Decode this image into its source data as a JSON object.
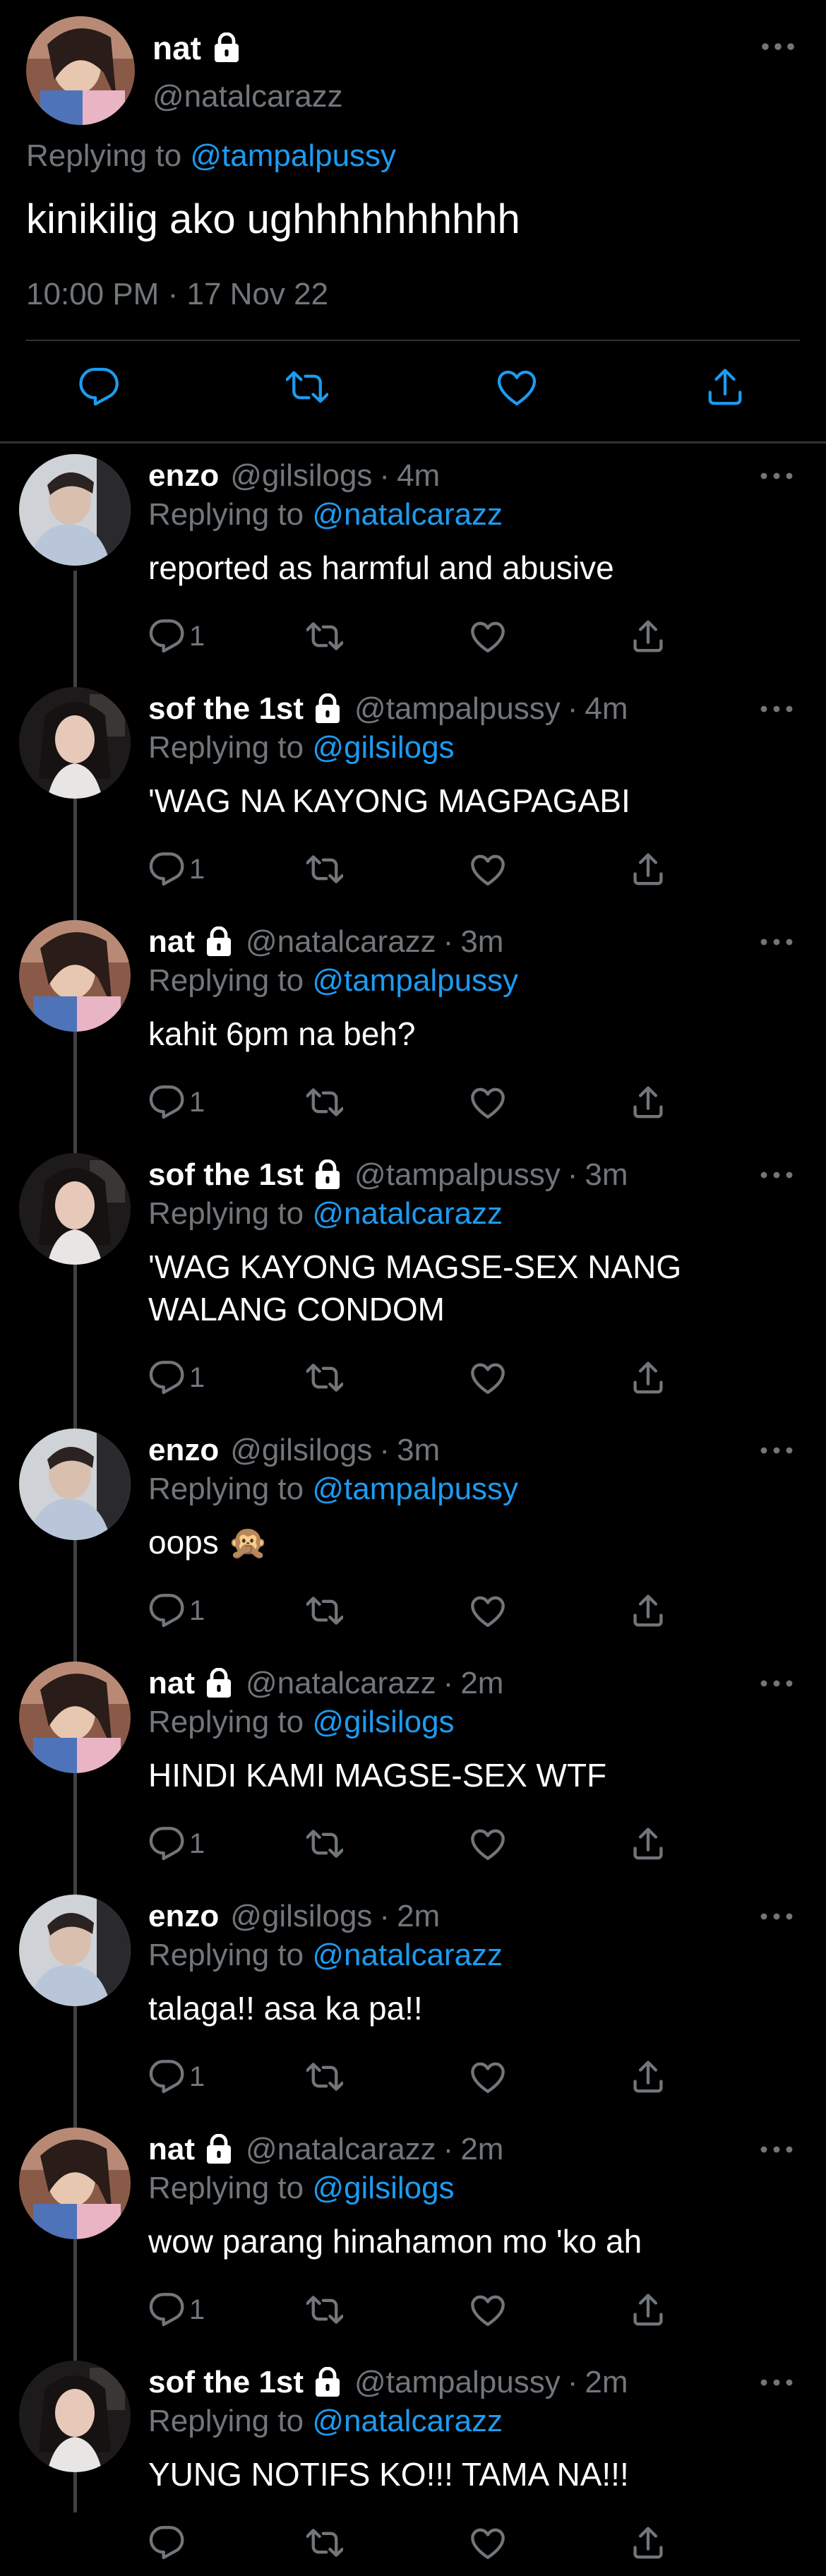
{
  "main_tweet": {
    "name": "nat",
    "handle": "@natalcarazz",
    "replying_prefix": "Replying to",
    "replying_to": "@tampalpussy",
    "text": "kinikilig ako ughhhhhhhhhh",
    "time": "10:00 PM",
    "separator": "·",
    "date": "17 Nov 22",
    "avatar": "avatar-nat",
    "locked": true
  },
  "replies": [
    {
      "name": "enzo",
      "locked": false,
      "handle": "@gilsilogs",
      "time": "4m",
      "replying_prefix": "Replying to",
      "replying_to": "@natalcarazz",
      "text": "reported as harmful and abusive",
      "reply_count": "1",
      "avatar": "avatar-enzo"
    },
    {
      "name": "sof the 1st",
      "locked": true,
      "handle": "@tampalpussy",
      "time": "4m",
      "replying_prefix": "Replying to",
      "replying_to": "@gilsilogs",
      "text": "'WAG NA KAYONG MAGPAGABI",
      "reply_count": "1",
      "avatar": "avatar-sof"
    },
    {
      "name": "nat",
      "locked": true,
      "handle": "@natalcarazz",
      "time": "3m",
      "replying_prefix": "Replying to",
      "replying_to": "@tampalpussy",
      "text": "kahit 6pm na beh?",
      "reply_count": "1",
      "avatar": "avatar-nat"
    },
    {
      "name": "sof the 1st",
      "locked": true,
      "handle": "@tampalpussy",
      "time": "3m",
      "replying_prefix": "Replying to",
      "replying_to": "@natalcarazz",
      "text": "'WAG KAYONG MAGSE-SEX NANG WALANG CONDOM",
      "reply_count": "1",
      "avatar": "avatar-sof"
    },
    {
      "name": "enzo",
      "locked": false,
      "handle": "@gilsilogs",
      "time": "3m",
      "replying_prefix": "Replying to",
      "replying_to": "@tampalpussy",
      "text": "oops 🙊",
      "reply_count": "1",
      "avatar": "avatar-enzo"
    },
    {
      "name": "nat",
      "locked": true,
      "handle": "@natalcarazz",
      "time": "2m",
      "replying_prefix": "Replying to",
      "replying_to": "@gilsilogs",
      "text": "HINDI KAMI MAGSE-SEX WTF",
      "reply_count": "1",
      "avatar": "avatar-nat"
    },
    {
      "name": "enzo",
      "locked": false,
      "handle": "@gilsilogs",
      "time": "2m",
      "replying_prefix": "Replying to",
      "replying_to": "@natalcarazz",
      "text": "talaga!! asa ka pa!!",
      "reply_count": "1",
      "avatar": "avatar-enzo"
    },
    {
      "name": "nat",
      "locked": true,
      "handle": "@natalcarazz",
      "time": "2m",
      "replying_prefix": "Replying to",
      "replying_to": "@gilsilogs",
      "text": "wow parang hinahamon mo 'ko ah",
      "reply_count": "1",
      "avatar": "avatar-nat"
    },
    {
      "name": "sof the 1st",
      "locked": true,
      "handle": "@tampalpussy",
      "time": "2m",
      "replying_prefix": "Replying to",
      "replying_to": "@natalcarazz",
      "text": "YUNG NOTIFS KO!!! TAMA NA!!!",
      "reply_count": "",
      "avatar": "avatar-sof"
    }
  ],
  "icons": {
    "reply": "reply-icon",
    "retweet": "retweet-icon",
    "like": "like-icon",
    "share": "share-icon",
    "more": "more-icon",
    "lock": "lock-icon"
  },
  "colors": {
    "background": "#000000",
    "text": "#ffffff",
    "secondary": "#71767b",
    "link": "#1d9bf0",
    "divider": "#2f3336"
  }
}
